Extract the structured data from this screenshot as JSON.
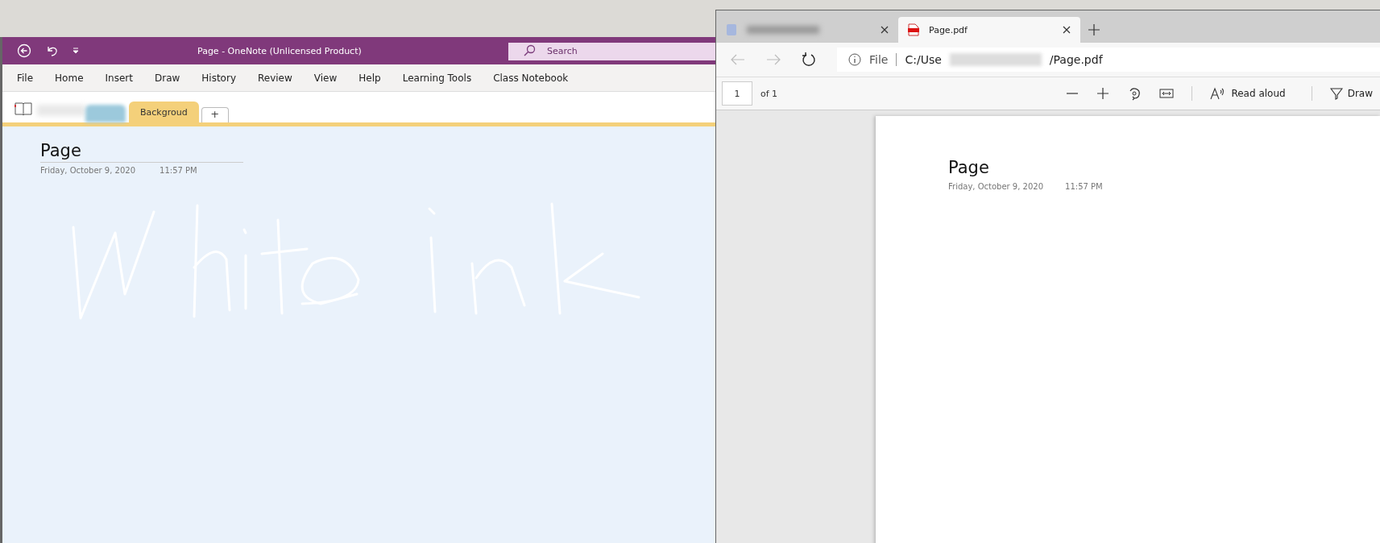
{
  "onenote": {
    "title": "Page  -  OneNote (Unlicensed Product)",
    "search": {
      "placeholder": "Search"
    },
    "menu": [
      "File",
      "Home",
      "Insert",
      "Draw",
      "History",
      "Review",
      "View",
      "Help",
      "Learning Tools",
      "Class Notebook"
    ],
    "section_tabs": [
      {
        "label": "Backgroud",
        "selected": true
      }
    ],
    "add_section": "+",
    "page": {
      "title": "Page",
      "date": "Friday, October 9, 2020",
      "time": "11:57 PM"
    }
  },
  "browser": {
    "tabs": [
      {
        "selected": false
      },
      {
        "label": "Page.pdf",
        "selected": true
      }
    ],
    "address": {
      "scheme": "File",
      "path_start": "C:/Use",
      "path_end": "/Page.pdf"
    },
    "pdf_toolbar": {
      "page": "1",
      "page_count": "of 1",
      "read_aloud": "Read aloud",
      "draw": "Draw"
    },
    "pdf_page": {
      "title": "Page",
      "date": "Friday, October 9, 2020",
      "time": "11:57 PM"
    }
  }
}
